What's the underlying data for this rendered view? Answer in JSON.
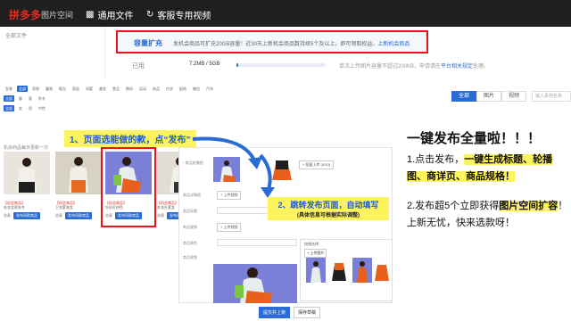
{
  "header": {
    "logo": "拼多多",
    "logo_sub": "图片空间",
    "nav_general": "通用文件",
    "nav_video": "客服专用视频"
  },
  "sidebar": {
    "all_files": "全部文件"
  },
  "capacity": {
    "title": "容量扩充",
    "text": "发机会商品可扩充20GB容量！近30天上新机会商品数持续5个及以上，即可领取权益。",
    "link": "上新机会商品"
  },
  "usage": {
    "label": "已用",
    "value": "7.2MB / 5GB",
    "progress_fraction": 0.0014,
    "note": "单次上传图片容量不超过200KB，申请请在",
    "note_link": "平台相关规定",
    "note_end": "处理。"
  },
  "tabs": [
    "全部",
    "图片",
    "视频"
  ],
  "search_placeholder": "输入素材名称",
  "filters": {
    "row1": [
      "女装",
      "全部",
      "男装",
      "童装",
      "鞋包",
      "家居",
      "母婴",
      "美妆",
      "食品",
      "数码",
      "运动",
      "饰品",
      "内衣",
      "配饰",
      "箱包",
      "汽车"
    ],
    "row2": [
      "全部",
      "春",
      "夏",
      "秋冬"
    ],
    "row3": [
      "全部",
      "女",
      "男",
      "中性"
    ],
    "sub": "筛选"
  },
  "grid_label": "机会商品每日更新一次",
  "products": [
    {
      "caption": "【机会商品】",
      "desc": "毛衣女款秋冬",
      "fav": "收藏",
      "publish": "发布同款商品"
    },
    {
      "caption": "【机会商品】",
      "desc": "卫衣套装女",
      "fav": "收藏",
      "publish": "发布同款商品"
    },
    {
      "caption": "【机会商品】",
      "desc": "针织衫拼色",
      "fav": "收藏",
      "publish": "发布同款商品"
    },
    {
      "caption": "【机会商品】",
      "desc": "毛衣外套女",
      "fav": "收藏",
      "publish": "发布同款商品"
    }
  ],
  "step1": "1、页面选能做的款，点“发布”",
  "step2": {
    "title": "2、跳转发布页面，自动填写",
    "note": "(具体信息可根据实际调整)"
  },
  "form": {
    "labels": [
      "* 商品轮播图",
      "商品详情图",
      "商品标题",
      "商品规格",
      "商品属性",
      "商品视频"
    ],
    "upload_main": "+ 上传视频",
    "upload_label": "+ 上传视频",
    "upload_link": "+ 批量上传 (5/10)",
    "submit": "提交并上架",
    "save": "保存草稿"
  },
  "gallery": {
    "title": "快捷选择",
    "upload": "+ 上传图片"
  },
  "promo": {
    "title": "一键发布全量啦！！！",
    "p1_a": "1.点击发布，",
    "p1_hl": "一键生成标题、轮播图、商详页、商品规格！",
    "p2_a": "2.发布超5个立即获得",
    "p2_hl": "图片空间扩容",
    "p2_b": "！",
    "p3": "上新无忧，快来选款呀！"
  }
}
